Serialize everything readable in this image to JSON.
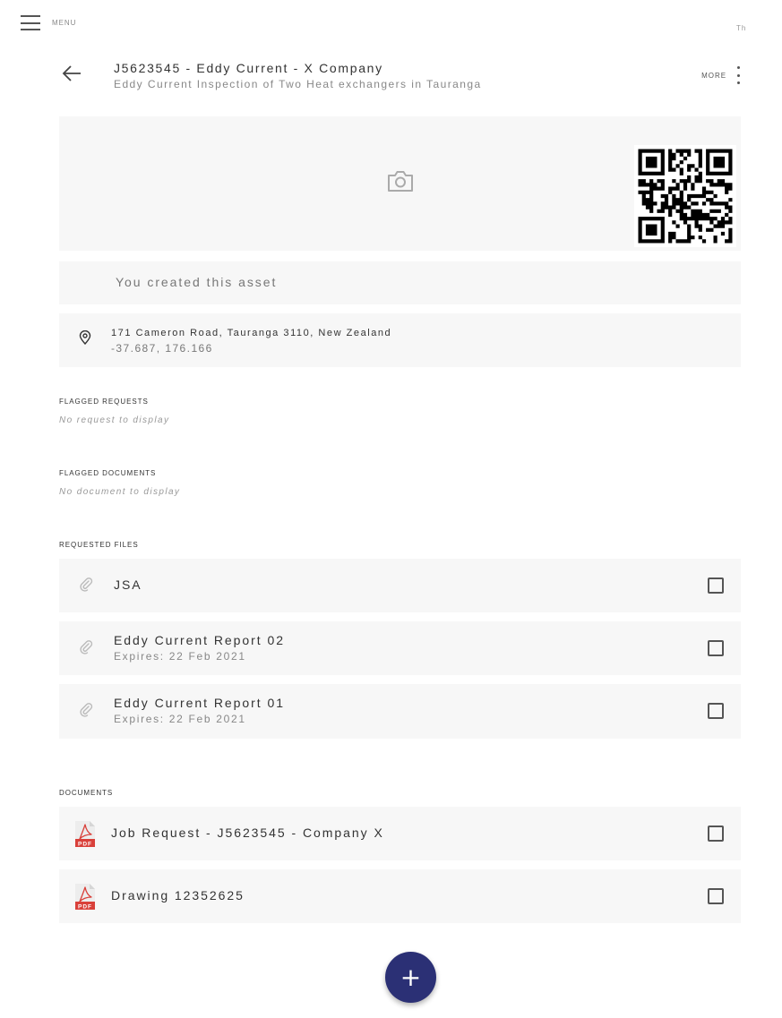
{
  "topbar": {
    "menu_label": "MENU",
    "corner_text": "Th"
  },
  "header": {
    "title": "J5623545 - Eddy Current - X Company",
    "subtitle": "Eddy Current Inspection of Two Heat exchangers in Tauranga",
    "more_label": "MORE"
  },
  "asset": {
    "created_text": "You created this asset",
    "address": "171 Cameron Road, Tauranga 3110, New Zealand",
    "coordinates": "-37.687, 176.166"
  },
  "sections": {
    "flagged_requests": {
      "heading": "FLAGGED REQUESTS",
      "empty": "No request to display"
    },
    "flagged_documents": {
      "heading": "FLAGGED DOCUMENTS",
      "empty": "No document to display"
    },
    "requested_files": {
      "heading": "REQUESTED FILES",
      "items": [
        {
          "title": "JSA",
          "subtitle": ""
        },
        {
          "title": "Eddy Current Report 02",
          "subtitle": "Expires: 22 Feb 2021"
        },
        {
          "title": "Eddy Current Report 01",
          "subtitle": "Expires: 22 Feb 2021"
        }
      ]
    },
    "documents": {
      "heading": "DOCUMENTS",
      "items": [
        {
          "title": "Job Request - J5623545 - Company X",
          "icon_label": "PDF"
        },
        {
          "title": "Drawing 12352625",
          "icon_label": "PDF"
        }
      ]
    }
  },
  "fab": {
    "label": "+"
  },
  "colors": {
    "accent": "#2b3075",
    "card_bg": "#f7f7f7",
    "pdf_red": "#d9403a"
  },
  "icons": [
    "menu-icon",
    "arrow-left-icon",
    "more-vert-icon",
    "camera-icon",
    "qr-code-image",
    "location-pin-icon",
    "paperclip-icon",
    "pdf-file-icon",
    "plus-icon"
  ]
}
